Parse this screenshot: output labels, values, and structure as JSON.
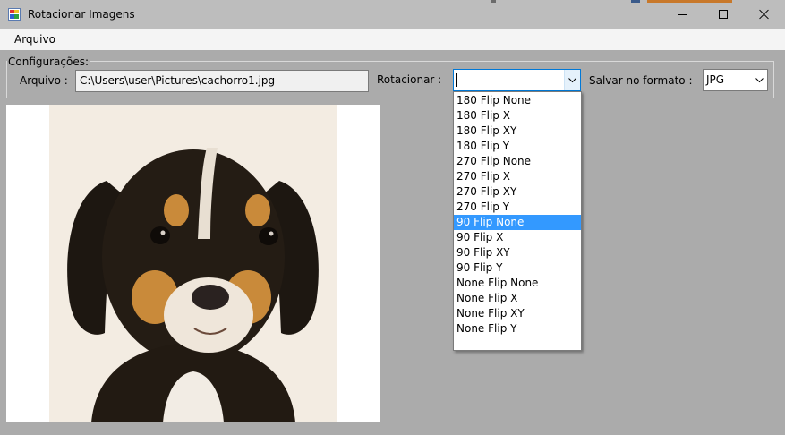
{
  "window": {
    "title": "Rotacionar Imagens"
  },
  "menu": {
    "items": [
      "Arquivo"
    ]
  },
  "config": {
    "legend": "Configurações:",
    "file_label": "Arquivo :",
    "file_path": "C:\\Users\\user\\Pictures\\cachorro1.jpg",
    "rotate_label": "Rotacionar :",
    "rotate_value": "",
    "format_label": "Salvar no formato :",
    "format_value": "JPG"
  },
  "rotate_options": [
    "180 Flip None",
    "180 Flip X",
    "180 Flip XY",
    "180 Flip Y",
    "270 Flip None",
    "270 Flip X",
    "270 Flip XY",
    "270 Flip Y",
    "90 Flip None",
    "90 Flip X",
    "90 Flip XY",
    "90 Flip Y",
    "None Flip None",
    "None Flip X",
    "None Flip XY",
    "None Flip Y"
  ],
  "rotate_highlighted": "90 Flip None",
  "colors": {
    "highlight": "#3399ff",
    "window_bg": "#ababab",
    "focus_border": "#0078d7"
  }
}
